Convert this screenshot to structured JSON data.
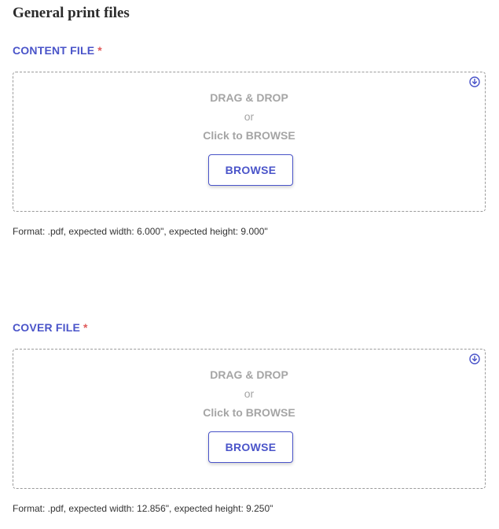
{
  "page": {
    "title": "General print files"
  },
  "colors": {
    "accent": "#4a54c9",
    "required": "#e05a5a",
    "muted_text": "#a5a5a5",
    "dashed_border": "#9a9a9a"
  },
  "content_file": {
    "label": "CONTENT FILE",
    "required_mark": "*",
    "dropzone": {
      "drag_text": "DRAG & DROP",
      "or_text": "or",
      "click_text": "Click to BROWSE",
      "browse_label": "BROWSE",
      "icon": "download-circle-icon"
    },
    "format_note": "Format: .pdf, expected width: 6.000\", expected height: 9.000\""
  },
  "cover_file": {
    "label": "COVER FILE",
    "required_mark": "*",
    "dropzone": {
      "drag_text": "DRAG & DROP",
      "or_text": "or",
      "click_text": "Click to BROWSE",
      "browse_label": "BROWSE",
      "icon": "download-circle-icon"
    },
    "format_note": "Format: .pdf, expected width: 12.856\", expected height: 9.250\""
  }
}
